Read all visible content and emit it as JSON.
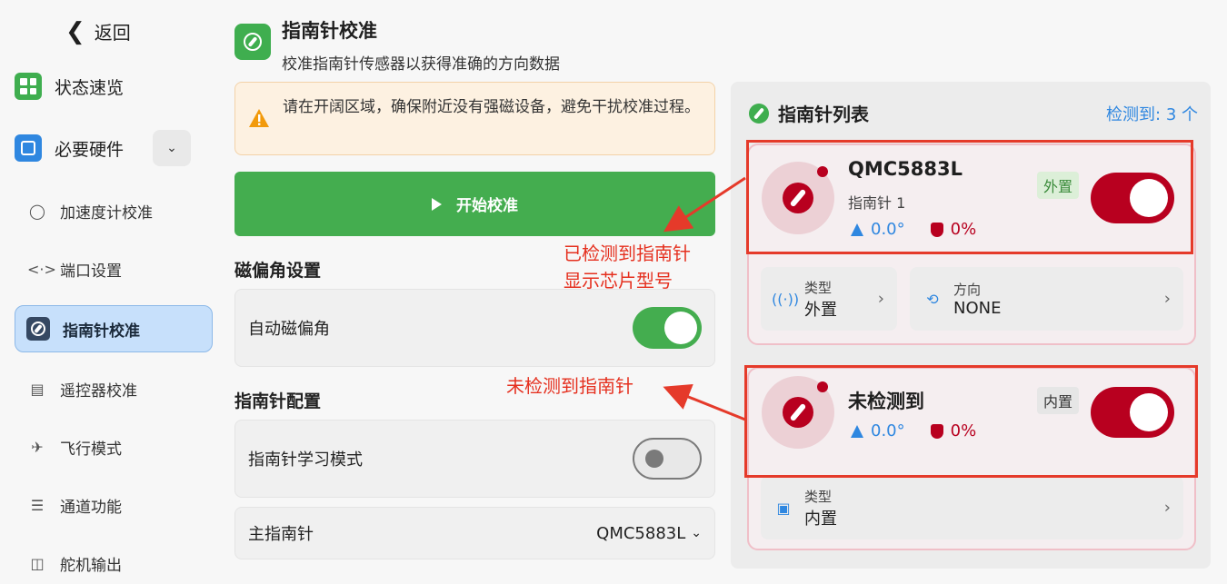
{
  "sidebar": {
    "back_label": "返回",
    "status_label": "状态速览",
    "hardware_label": "必要硬件",
    "items": [
      {
        "label": "加速度计校准",
        "icon": "gauge-icon"
      },
      {
        "label": "端口设置",
        "icon": "code-arrows-icon"
      },
      {
        "label": "指南针校准",
        "icon": "compass-icon"
      },
      {
        "label": "遥控器校准",
        "icon": "radio-icon"
      },
      {
        "label": "飞行模式",
        "icon": "airplane-icon"
      },
      {
        "label": "通道功能",
        "icon": "sliders-icon"
      },
      {
        "label": "舵机输出",
        "icon": "servo-icon"
      }
    ]
  },
  "header": {
    "title": "指南针校准",
    "subtitle": "校准指南针传感器以获得准确的方向数据"
  },
  "warning": {
    "text": "请在开阔区域，确保附近没有强磁设备，避免干扰校准过程。"
  },
  "start_button": {
    "label": "开始校准"
  },
  "declination": {
    "section_title": "磁偏角设置",
    "auto_label": "自动磁偏角",
    "auto_on": true
  },
  "compass_config": {
    "section_title": "指南针配置",
    "learn_label": "指南针学习模式",
    "learn_on": false,
    "primary_label": "主指南针",
    "primary_value": "QMC5883L"
  },
  "compass_list": {
    "title": "指南针列表",
    "detected": "检测到: 3 个",
    "items": [
      {
        "name": "QMC5883L",
        "sub": "指南针 1",
        "heading": "0.0°",
        "health": "0%",
        "tag": "外置",
        "enabled": true,
        "type_label": "类型",
        "type_value": "外置",
        "orient_label": "方向",
        "orient_value": "NONE"
      },
      {
        "name": "未检测到",
        "heading": "0.0°",
        "health": "0%",
        "tag": "内置",
        "enabled": true,
        "type_label": "类型",
        "type_value": "内置"
      }
    ]
  },
  "annotations": {
    "detected_line1": "已检测到指南针",
    "detected_line2": "显示芯片型号",
    "not_detected": "未检测到指南针"
  },
  "colors": {
    "accent_green": "#44ad4f",
    "accent_blue": "#2f87e0",
    "accent_red": "#b8001f",
    "annotation_red": "#e53a2a"
  }
}
